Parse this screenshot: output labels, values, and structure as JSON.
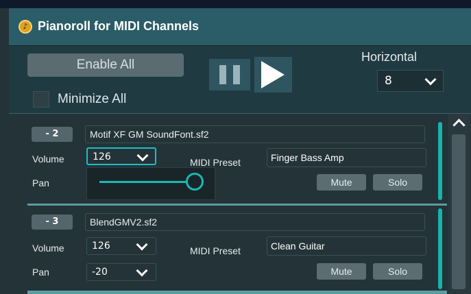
{
  "window": {
    "title": "Pianoroll for MIDI Channels",
    "icon": "music-note-icon"
  },
  "controls": {
    "enable_all_label": "Enable All",
    "minimize_all_label": "Minimize All",
    "pause_icon": "pause-icon",
    "play_icon": "play-icon",
    "horizontal_label": "Horizontal",
    "horizontal_value": "8"
  },
  "channels": [
    {
      "number_label": "- 2",
      "soundfont": "Motif XF GM SoundFont.sf2",
      "volume_label": "Volume",
      "volume_value": "126",
      "midi_preset_label": "MIDI Preset",
      "midi_preset_value": "Finger Bass Amp",
      "pan_label": "Pan",
      "pan_slider_fraction": 0.95,
      "mute_label": "Mute",
      "solo_label": "Solo"
    },
    {
      "number_label": "- 3",
      "soundfont": "BlendGMV2.sf2",
      "volume_label": "Volume",
      "volume_value": "126",
      "midi_preset_label": "MIDI Preset",
      "midi_preset_value": "Clean Guitar",
      "pan_label": "Pan",
      "pan_value": "-20",
      "mute_label": "Mute",
      "solo_label": "Solo"
    }
  ],
  "colors": {
    "accent": "#17b3ad",
    "titlebar": "#2b5d68",
    "background": "#243338"
  }
}
